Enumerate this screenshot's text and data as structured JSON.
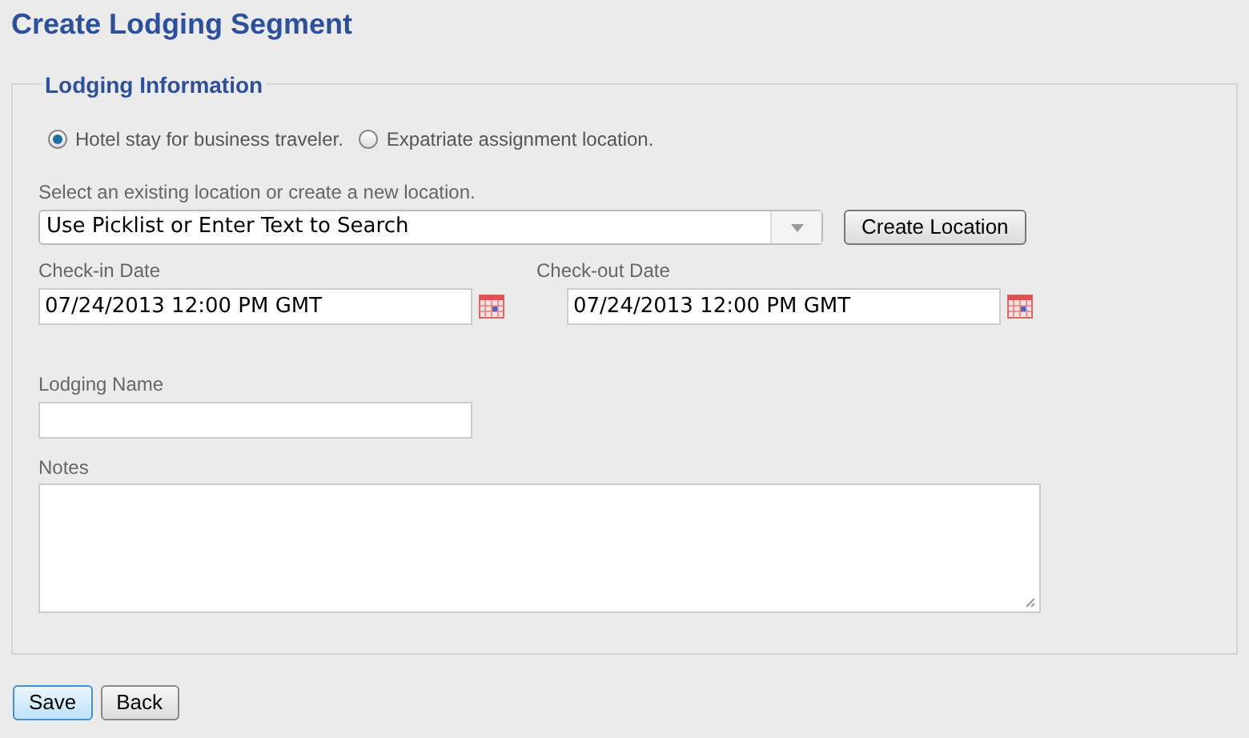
{
  "title": "Create Lodging Segment",
  "section": {
    "legend": "Lodging Information",
    "stay_types": [
      {
        "label": "Hotel stay for business traveler.",
        "selected": true
      },
      {
        "label": "Expatriate assignment location.",
        "selected": false
      }
    ],
    "location": {
      "label": "Select an existing location or create a new location.",
      "value": "Use Picklist or Enter Text to Search",
      "button": "Create Location"
    },
    "check_in": {
      "label": "Check-in Date",
      "value": "07/24/2013 12:00 PM GMT"
    },
    "check_out": {
      "label": "Check-out Date",
      "value": "07/24/2013 12:00 PM GMT"
    },
    "lodging_name": {
      "label": "Lodging Name"
    },
    "notes": {
      "label": "Notes"
    }
  },
  "buttons": [
    {
      "label": "Save",
      "kind": "primary"
    },
    {
      "label": "Back",
      "kind": "secondary"
    }
  ]
}
